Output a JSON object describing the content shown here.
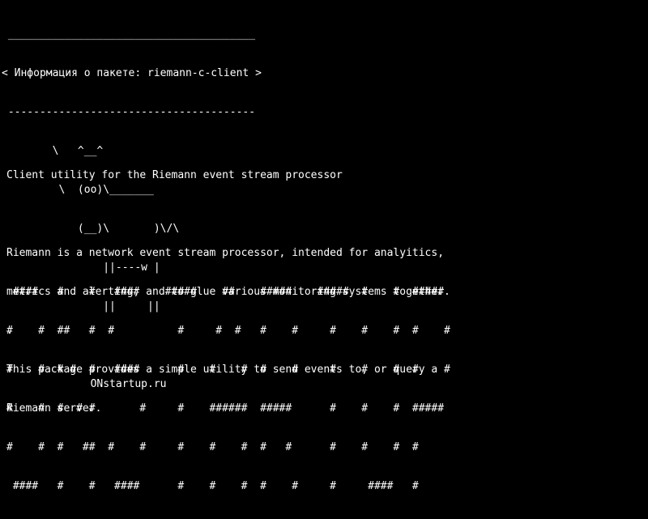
{
  "terminal": {
    "background": "#000000",
    "foreground": "#ffffff",
    "cowsay": {
      "lines": [
        " _______________________________________",
        "< Информация о пакете: riemann-c-client >",
        " ---------------------------------------",
        "        \\   ^__^",
        "         \\  (oo)\\_______",
        "            (__)\\       )\\/\\",
        "                ||----w |",
        "                ||     ||",
        "",
        "              ONstartup.ru"
      ]
    },
    "description": {
      "lines": [
        "Client utility for the Riemann event stream processor",
        "",
        "Riemann is a network event stream processor, intended for analyitics,",
        "metrics and alerting; and to glue various monitoring systems together.",
        ".",
        "This package provides a simple utility to send events to, or query a",
        "Riemann server."
      ]
    },
    "banner": {
      "lines": [
        " ####   #    #   ####    #####    ##    #####    #####  #    #  #####",
        "#    #  ##   #  #          #     #  #   #    #     #    #    #  #    #",
        "#    #  # #  #   ####      #    #    #  #    #     #    #    #  #    #",
        "#    #  #  # #       #     #    ######  #####      #    #    #  #####",
        "#    #  #   ##  #    #     #    #    #  #   #      #    #    #  #",
        " ####   #    #   ####      #    #    #  #    #     #     ####   #"
      ]
    }
  }
}
